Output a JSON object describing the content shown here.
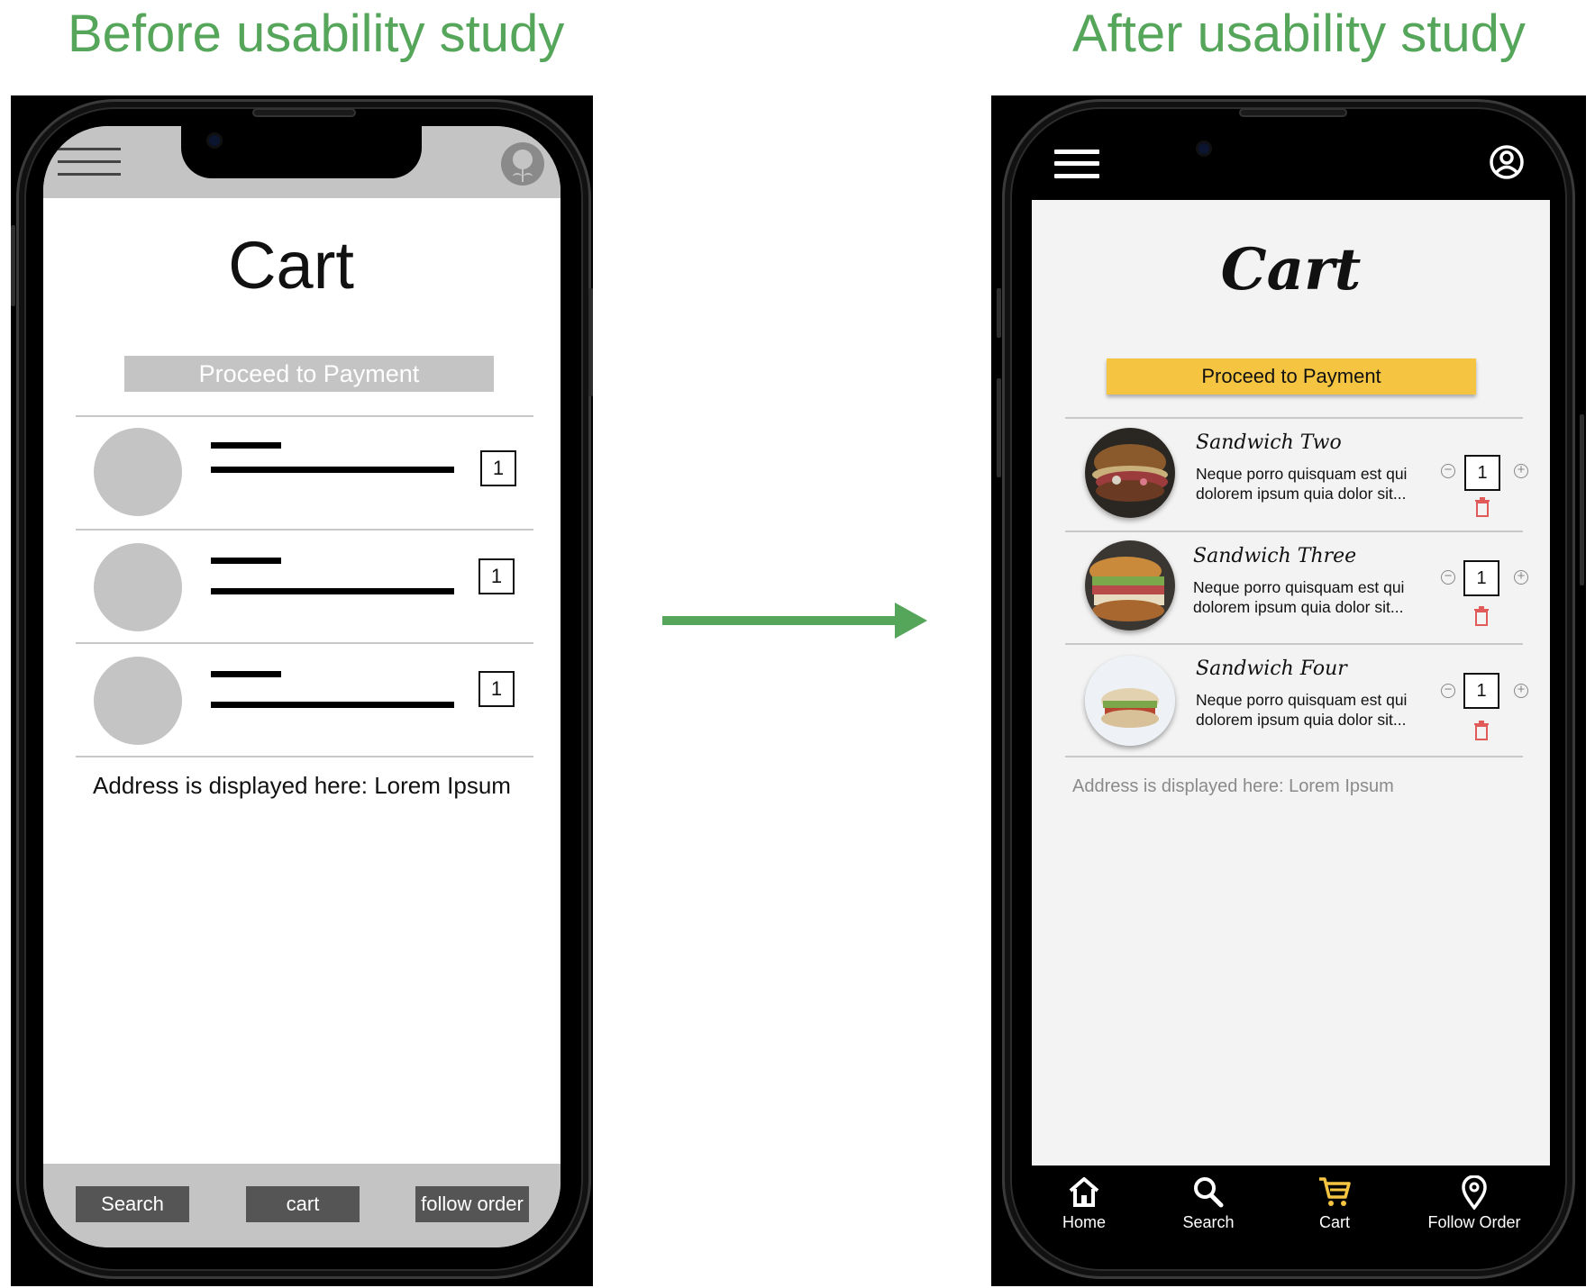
{
  "headings": {
    "before": "Before usability study",
    "after": "After usability study"
  },
  "colors": {
    "heading": "#55a65a",
    "arrow": "#55a65a",
    "wireframe_gray": "#c4c4c4",
    "accent_yellow": "#f5c542",
    "delete_red": "#e05a5a"
  },
  "before": {
    "title": "Cart",
    "proceed_label": "Proceed to Payment",
    "items": [
      {
        "qty": "1"
      },
      {
        "qty": "1"
      },
      {
        "qty": "1"
      }
    ],
    "address": "Address is displayed here: Lorem Ipsum",
    "bottom_nav": [
      "Search",
      "cart",
      "follow order"
    ]
  },
  "after": {
    "title": "Cart",
    "proceed_label": "Proceed to Payment",
    "items": [
      {
        "name": "Sandwich Two",
        "description": "Neque porro quisquam est qui dolorem ipsum quia dolor sit...",
        "qty": "1"
      },
      {
        "name": "Sandwich Three",
        "description": "Neque porro quisquam est qui dolorem ipsum quia dolor sit...",
        "qty": "1"
      },
      {
        "name": "Sandwich Four",
        "description": "Neque porro quisquam est qui dolorem ipsum quia dolor sit...",
        "qty": "1"
      }
    ],
    "address": "Address is displayed here: Lorem Ipsum",
    "bottom_nav": [
      {
        "label": "Home",
        "icon": "home-icon"
      },
      {
        "label": "Search",
        "icon": "search-icon"
      },
      {
        "label": "Cart",
        "icon": "cart-icon",
        "active": true
      },
      {
        "label": "Follow Order",
        "icon": "location-pin-icon"
      }
    ]
  }
}
